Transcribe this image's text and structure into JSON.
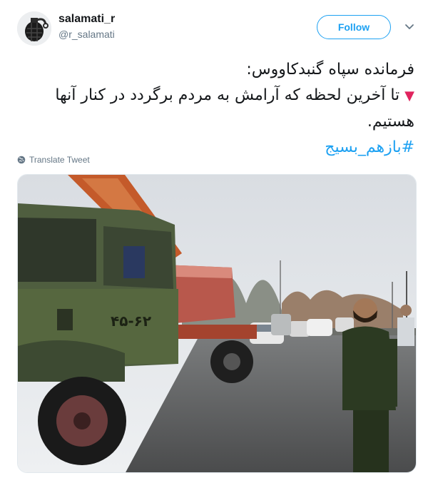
{
  "tweet": {
    "display_name": "salamati_r",
    "handle": "@r_salamati",
    "follow_label": "Follow",
    "text_lines": [
      "فرمانده سپاه گنبدکاووس:",
      "تا آخرین لحظه که آرامش به مردم برگردد در کنار آنها",
      "هستیم."
    ],
    "bullet_icon": "red-triangle-down",
    "hashtag": "#بازهم_بسیج",
    "translate_label": "Translate Tweet",
    "truck_plate": "۴۵-۶۲"
  },
  "colors": {
    "accent": "#1da1f2",
    "secondary_text": "#657786",
    "bullet": "#e0245e"
  },
  "icons": {
    "avatar": "grenade-avatar-icon",
    "caret": "chevron-down-icon",
    "translate": "globe-icon"
  }
}
